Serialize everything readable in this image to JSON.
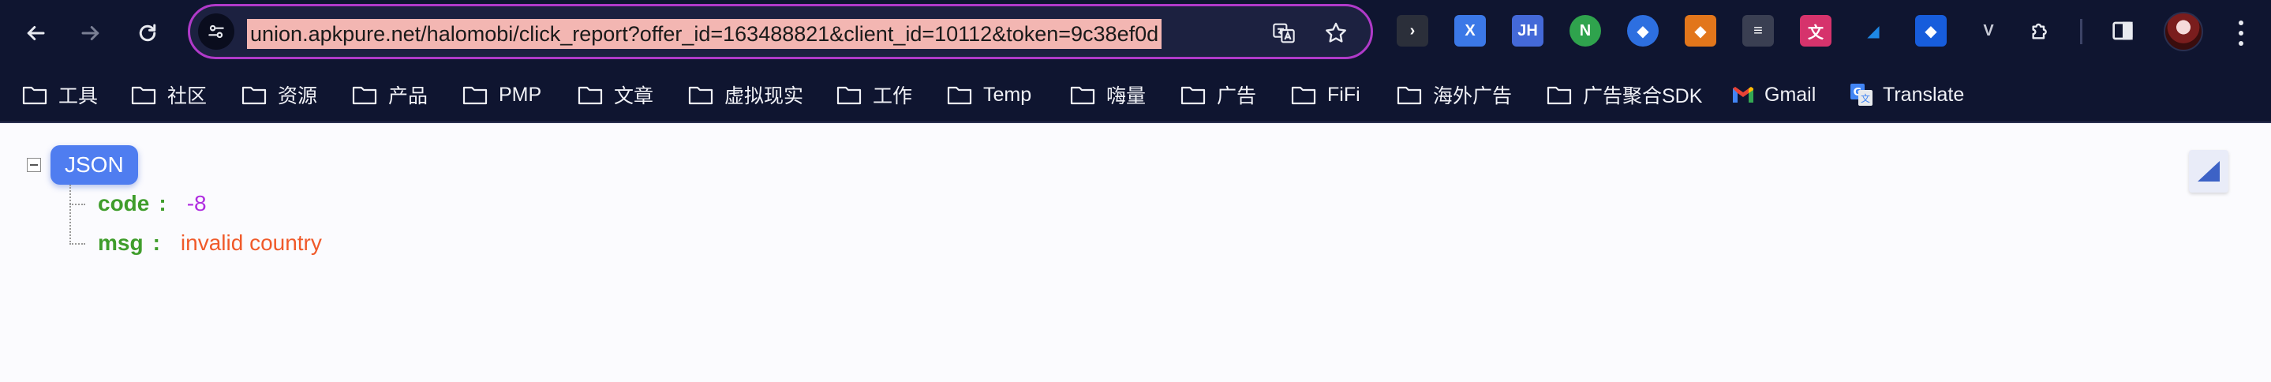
{
  "browser": {
    "url": "union.apkpure.net/halomobi/click_report?offer_id=163488821&client_id=10112&token=9c38ef0d",
    "accent_color": "#b03ac9",
    "toolbar_color": "#0f1530"
  },
  "bookmarks": [
    {
      "label": "工具",
      "icon": "folder-icon"
    },
    {
      "label": "社区",
      "icon": "folder-icon"
    },
    {
      "label": "资源",
      "icon": "folder-icon"
    },
    {
      "label": "产品",
      "icon": "folder-icon"
    },
    {
      "label": "PMP",
      "icon": "folder-icon"
    },
    {
      "label": "文章",
      "icon": "folder-icon"
    },
    {
      "label": "虚拟现实",
      "icon": "folder-icon"
    },
    {
      "label": "工作",
      "icon": "folder-icon"
    },
    {
      "label": "Temp",
      "icon": "folder-icon"
    },
    {
      "label": "嗨量",
      "icon": "folder-icon"
    },
    {
      "label": "广告",
      "icon": "folder-icon"
    },
    {
      "label": "FiFi",
      "icon": "folder-icon"
    },
    {
      "label": "海外广告",
      "icon": "folder-icon"
    },
    {
      "label": "广告聚合SDK",
      "icon": "folder-icon"
    },
    {
      "label": "Gmail",
      "icon": "gmail-icon"
    },
    {
      "label": "Translate",
      "icon": "google-translate-icon"
    }
  ],
  "extensions": [
    {
      "name": "terminal-extension-icon",
      "glyph": "›",
      "color": "#2b2f3a"
    },
    {
      "name": "x-extension-icon",
      "glyph": "X",
      "color": "#3b78e7"
    },
    {
      "name": "jh-extension-icon",
      "glyph": "JH",
      "color": "#4469d8"
    },
    {
      "name": "n-extension-icon",
      "glyph": "N",
      "color": "#2fa34d"
    },
    {
      "name": "bird-extension-icon",
      "glyph": "◆",
      "color": "#2d6fe0"
    },
    {
      "name": "metamask-fox-icon",
      "glyph": "◆",
      "color": "#e2761b"
    },
    {
      "name": "dev-tools-extension-icon",
      "glyph": "≡",
      "color": "#3a3f52"
    },
    {
      "name": "translate-extension-icon",
      "glyph": "文",
      "color": "#d6336c"
    },
    {
      "name": "v-extension-icon",
      "glyph": "◢",
      "color": "#1e88e5"
    },
    {
      "name": "bitwarden-shield-icon",
      "glyph": "◆",
      "color": "#175ddc"
    },
    {
      "name": "vue-devtools-icon",
      "glyph": "V",
      "color": "#6b6f80"
    }
  ],
  "json_viewer": {
    "root_label": "JSON",
    "fields": [
      {
        "key": "code",
        "value": "-8",
        "type": "number"
      },
      {
        "key": "msg",
        "value": "invalid country",
        "type": "string"
      }
    ],
    "colors": {
      "key": "#3f9d2b",
      "number": "#b02de0",
      "string": "#f05a2a",
      "badge": "#4f7df0"
    }
  }
}
